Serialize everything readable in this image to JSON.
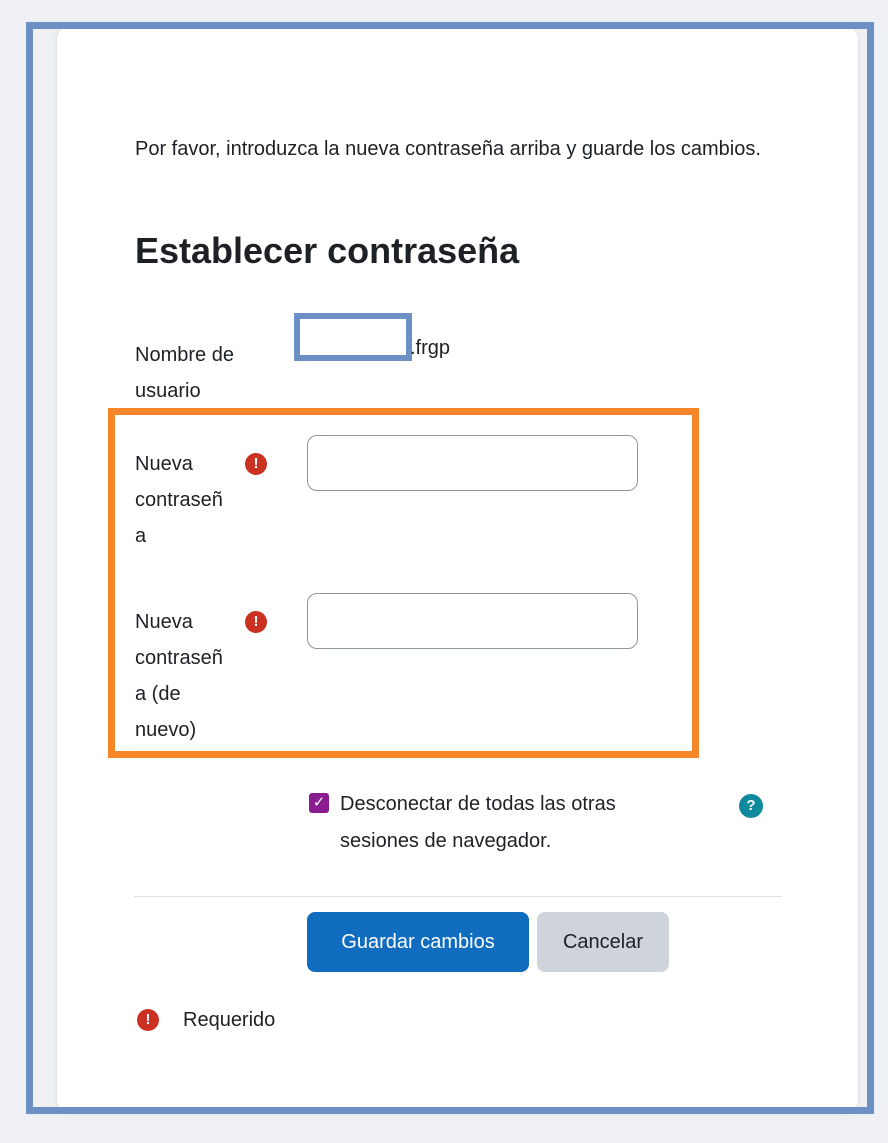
{
  "intro_text": "Por favor, introduzca la nueva contraseña arriba y guarde los cambios.",
  "heading": "Establecer contraseña",
  "username": {
    "label_line1": "Nombre de",
    "label_line2": "usuario",
    "value_suffix": ".frgp"
  },
  "new_password": {
    "label_line1": "Nueva",
    "label_line2": "contraseñ",
    "label_line3": "a",
    "value": ""
  },
  "new_password_again": {
    "label_line1": "Nueva",
    "label_line2": "contraseñ",
    "label_line3": "a (de",
    "label_line4": "nuevo)",
    "value": ""
  },
  "logout_sessions": {
    "checked": true,
    "label_line1": "Desconectar de todas las otras",
    "label_line2": "sesiones de navegador."
  },
  "buttons": {
    "save": "Guardar cambios",
    "cancel": "Cancelar"
  },
  "required_note": "Requerido",
  "icons": {
    "required": "exclamation-circle-icon",
    "help": "question-circle-icon",
    "check": "checkmark-icon"
  },
  "colors": {
    "primary": "#0f6cbf",
    "required": "#ca3120",
    "checkbox": "#8a1b91",
    "help": "#0f8a9c",
    "annotation_blue": "#6c8fc4",
    "annotation_orange": "#f6862a"
  }
}
